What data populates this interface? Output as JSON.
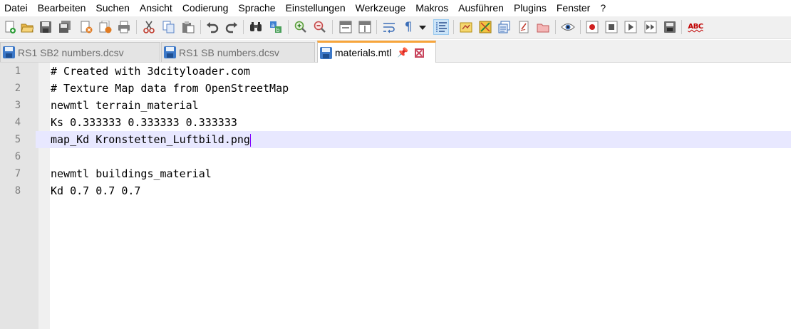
{
  "menu": [
    "Datei",
    "Bearbeiten",
    "Suchen",
    "Ansicht",
    "Codierung",
    "Sprache",
    "Einstellungen",
    "Werkzeuge",
    "Makros",
    "Ausführen",
    "Plugins",
    "Fenster",
    "?"
  ],
  "toolbar": {
    "spell_check_label": "ABC"
  },
  "tabs": [
    {
      "label": "RS1 SB2 numbers.dcsv",
      "active": false
    },
    {
      "label": "RS1 SB numbers.dcsv",
      "active": false
    },
    {
      "label": "materials.mtl",
      "active": true
    }
  ],
  "tab_pin_glyph": "📌",
  "editor": {
    "current_line": 5,
    "lines": [
      {
        "n": "1",
        "text": "# Created with 3dcityloader.com"
      },
      {
        "n": "2",
        "text": "# Texture Map data from OpenStreetMap"
      },
      {
        "n": "3",
        "text": "newmtl terrain_material"
      },
      {
        "n": "4",
        "text": "Ks 0.333333 0.333333 0.333333"
      },
      {
        "n": "5",
        "text": "map_Kd Kronstetten_Luftbild.png"
      },
      {
        "n": "6",
        "text": ""
      },
      {
        "n": "7",
        "text": "newmtl buildings_material"
      },
      {
        "n": "8",
        "text": "Kd 0.7 0.7 0.7"
      }
    ]
  },
  "colors": {
    "active_tab_accent": "#f7a53b",
    "current_line_bg": "#e8e8ff",
    "caret": "#8000ff"
  }
}
